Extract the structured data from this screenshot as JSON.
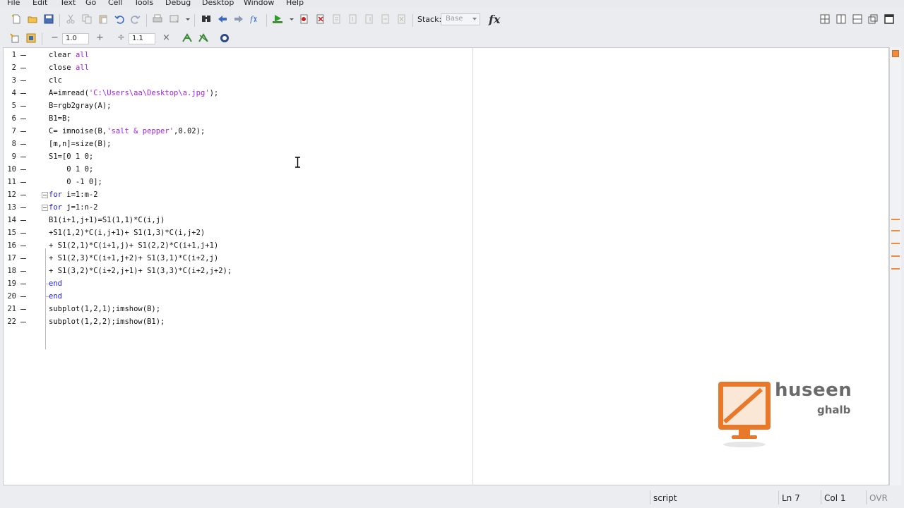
{
  "menubar": [
    "File",
    "Edit",
    "Text",
    "Go",
    "Cell",
    "Tools",
    "Debug",
    "Desktop",
    "Window",
    "Help"
  ],
  "toolbar": {
    "stack_label": "Stack:",
    "stack_value": "Base",
    "fx_label": "fx",
    "icons": [
      "new-file-icon",
      "open-folder-icon",
      "save-icon",
      "cut-icon",
      "copy-icon",
      "paste-icon",
      "undo-icon",
      "redo-icon",
      "print-icon",
      "find-icon",
      "back-icon",
      "forward-icon",
      "function-browser-icon",
      "run-icon",
      "set-breakpoint-icon",
      "clear-breakpoints-icon",
      "step-icon",
      "step-in-icon",
      "step-out-icon",
      "continue-icon",
      "exit-debug-icon",
      "tile-icon",
      "split-vertical-icon",
      "split-horizontal-icon",
      "float-icon",
      "maximize-icon"
    ]
  },
  "cell_toolbar": {
    "decrement_label": "−",
    "value1": "1.0",
    "increment_label": "+",
    "divide_label": "÷",
    "value2": "1.1",
    "close_label": "×"
  },
  "editor": {
    "lines": [
      {
        "n": "1",
        "code": [
          {
            "t": "clear ",
            "c": ""
          },
          {
            "t": "all",
            "c": "str"
          }
        ]
      },
      {
        "n": "2",
        "code": [
          {
            "t": "close ",
            "c": ""
          },
          {
            "t": "all",
            "c": "str"
          }
        ]
      },
      {
        "n": "3",
        "code": [
          {
            "t": "clc",
            "c": ""
          }
        ]
      },
      {
        "n": "4",
        "code": [
          {
            "t": "A=imread(",
            "c": ""
          },
          {
            "t": "'C:\\Users\\aa\\Desktop\\a.jpg'",
            "c": "str"
          },
          {
            "t": ");",
            "c": ""
          }
        ]
      },
      {
        "n": "5",
        "code": [
          {
            "t": "B=rgb2gray(A);",
            "c": ""
          }
        ]
      },
      {
        "n": "6",
        "code": [
          {
            "t": "B1=B;",
            "c": ""
          }
        ]
      },
      {
        "n": "7",
        "code": [
          {
            "t": "C= imnoise(B,",
            "c": ""
          },
          {
            "t": "'salt & pepper'",
            "c": "str"
          },
          {
            "t": ",0.02);",
            "c": ""
          }
        ]
      },
      {
        "n": "8",
        "code": [
          {
            "t": "[m,n]=size(B);",
            "c": ""
          }
        ]
      },
      {
        "n": "9",
        "code": [
          {
            "t": "S1=[0 1 0;",
            "c": ""
          }
        ]
      },
      {
        "n": "10",
        "code": [
          {
            "t": "    0 1 0;",
            "c": ""
          }
        ]
      },
      {
        "n": "11",
        "code": [
          {
            "t": "    0 -1 0];",
            "c": ""
          }
        ]
      },
      {
        "n": "12",
        "code": [
          {
            "t": "for",
            "c": "kw"
          },
          {
            "t": " i=1:m-2",
            "c": ""
          }
        ]
      },
      {
        "n": "13",
        "code": [
          {
            "t": "for",
            "c": "kw"
          },
          {
            "t": " j=1:n-2",
            "c": ""
          }
        ]
      },
      {
        "n": "14",
        "code": [
          {
            "t": "B1(i+1,j+1)=S1(1,1)*C(i,j)",
            "c": ""
          }
        ]
      },
      {
        "n": "15",
        "code": [
          {
            "t": "+S1(1,2)*C(i,j+1)+ S1(1,3)*C(i,j+2)",
            "c": ""
          }
        ]
      },
      {
        "n": "16",
        "code": [
          {
            "t": "+ S1(2,1)*C(i+1,j)+ S1(2,2)*C(i+1,j+1)",
            "c": ""
          }
        ]
      },
      {
        "n": "17",
        "code": [
          {
            "t": "+ S1(2,3)*C(i+1,j+2)+ S1(3,1)*C(i+2,j)",
            "c": ""
          }
        ]
      },
      {
        "n": "18",
        "code": [
          {
            "t": "+ S1(3,2)*C(i+2,j+1)+ S1(3,3)*C(i+2,j+2);",
            "c": ""
          }
        ]
      },
      {
        "n": "19",
        "code": [
          {
            "t": "end",
            "c": "kw"
          }
        ]
      },
      {
        "n": "20",
        "code": [
          {
            "t": "end",
            "c": "kw"
          }
        ]
      },
      {
        "n": "21",
        "code": [
          {
            "t": "subplot(1,2,1);imshow(B);",
            "c": ""
          }
        ]
      },
      {
        "n": "22",
        "code": [
          {
            "t": "subplot(1,2,2);imshow(B1);",
            "c": ""
          }
        ]
      }
    ]
  },
  "watermark": {
    "name": "huseen",
    "sub": "ghalb"
  },
  "status": {
    "mode": "script",
    "ln": "Ln  7",
    "col": "Col  1",
    "ovr": "OVR"
  },
  "colors": {
    "keyword": "#1a1aff",
    "string": "#a020f0",
    "warning": "#f08a3c",
    "logo_orange": "#e8782a"
  }
}
